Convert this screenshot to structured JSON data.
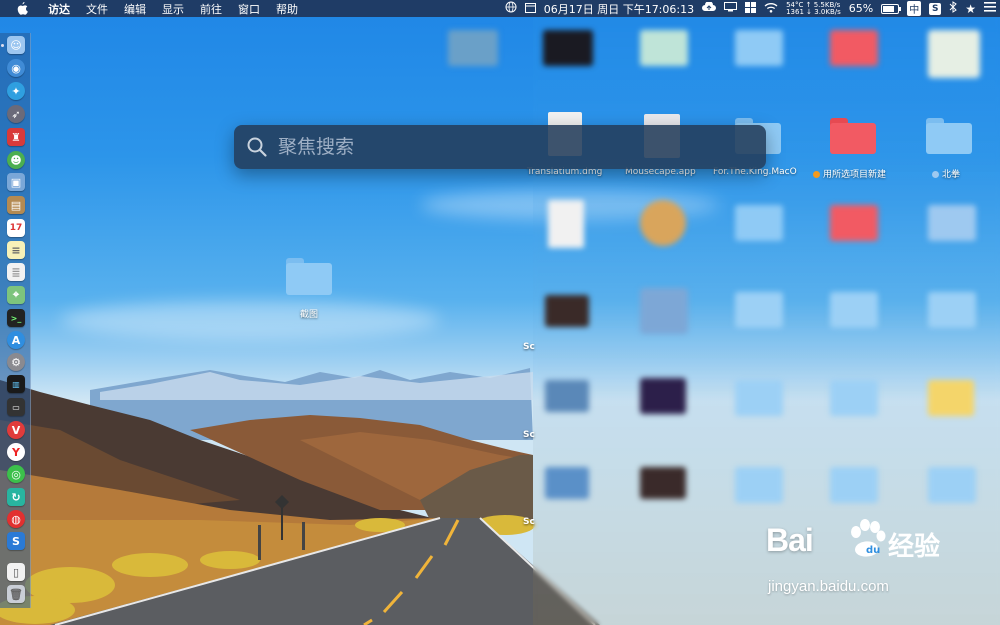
{
  "menubar": {
    "app_name": "访达",
    "items": [
      "文件",
      "编辑",
      "显示",
      "前往",
      "窗口",
      "帮助"
    ],
    "status": {
      "datetime": "06月17日 周日 下午17:06:13",
      "temperature": "54°C",
      "fan": "1361",
      "net_up": "↑ 5.5KB/s",
      "net_down": "↓ 3.0KB/s",
      "battery": "65%",
      "input_method": "中"
    }
  },
  "spotlight": {
    "placeholder": "聚焦搜索"
  },
  "desktop": {
    "folder_label": "截图",
    "visible_items": [
      {
        "label": "Translatium.dmg"
      },
      {
        "label": "Mousecape.app"
      },
      {
        "label": "For.The.King.MacO"
      },
      {
        "label": "用所选项目新建",
        "tag_color": "#f39a1e"
      },
      {
        "label": "北拳",
        "tag_color": "#9ec9f0"
      }
    ],
    "partial_labels": [
      "Sc",
      "Sc",
      "Sc"
    ]
  },
  "watermark": {
    "brand": "Bai",
    "brand2": "du",
    "experience": "经验",
    "url": "jingyan.baidu.com"
  },
  "colors": {
    "menubar_bg": "#1f3c66",
    "folder_blue": "#8fcaf5",
    "folder_red": "#f25a63",
    "spotlight_bg": "#233c5a"
  }
}
